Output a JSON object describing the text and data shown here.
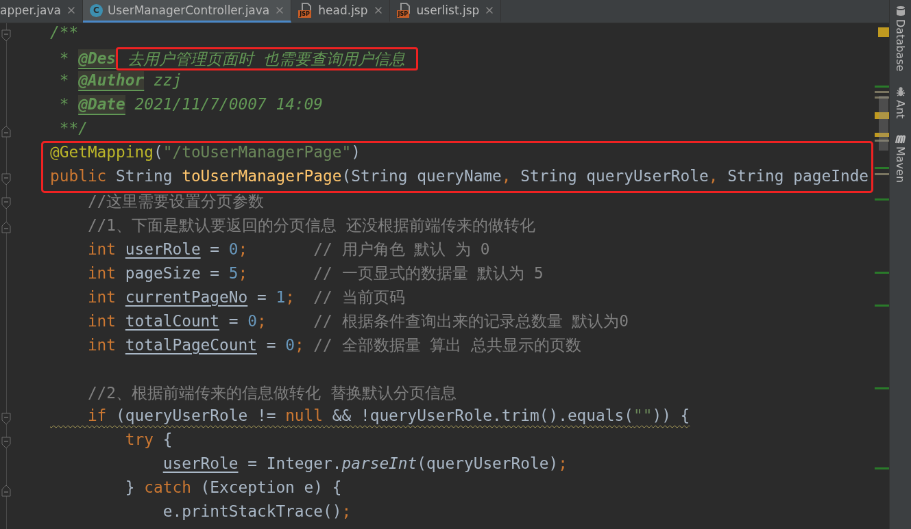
{
  "tabs": [
    {
      "label": "apper.java",
      "kind": "plain",
      "selected": false
    },
    {
      "label": "UserManagerController.java",
      "kind": "class",
      "badge": "C",
      "selected": true
    },
    {
      "label": "head.jsp",
      "kind": "jsp",
      "badge": "JSP",
      "selected": false
    },
    {
      "label": "userlist.jsp",
      "kind": "jsp",
      "badge": "JSP",
      "selected": false
    }
  ],
  "lines": [
    {
      "fold_start": true,
      "tokens": [
        {
          "kind": "doc",
          "t": "/**"
        }
      ]
    },
    {
      "tokens": [
        {
          "kind": "doc",
          "t": " * "
        },
        {
          "kind": "doctag",
          "t": "@Des"
        },
        {
          "kind": "doc",
          "t": " 去用户管理页面时 也需要查询用户信息",
          "boxed": true
        }
      ]
    },
    {
      "tokens": [
        {
          "kind": "doc",
          "t": " * "
        },
        {
          "kind": "doctag",
          "t": "@Author"
        },
        {
          "kind": "doc",
          "t": " zzj"
        }
      ]
    },
    {
      "tokens": [
        {
          "kind": "doc",
          "t": " * "
        },
        {
          "kind": "doctag",
          "t": "@Date"
        },
        {
          "kind": "doc",
          "t": " 2021/11/7/0007 14:09"
        }
      ]
    },
    {
      "fold_end": true,
      "tokens": [
        {
          "kind": "doc",
          "t": " **/"
        }
      ]
    },
    {
      "boxed": true,
      "tokens": [
        {
          "kind": "ann",
          "t": "@GetMapping"
        },
        {
          "kind": "plain",
          "t": "("
        },
        {
          "kind": "str",
          "t": "\"/toUserManagerPage\""
        },
        {
          "kind": "plain",
          "t": ")"
        }
      ]
    },
    {
      "boxed": true,
      "fold_start": true,
      "tokens": [
        {
          "kind": "kw",
          "t": "public "
        },
        {
          "kind": "plain",
          "t": "String "
        },
        {
          "kind": "fn",
          "t": "toUserManagerPage"
        },
        {
          "kind": "plain",
          "t": "(String queryName"
        },
        {
          "kind": "punct",
          "t": ", "
        },
        {
          "kind": "plain",
          "t": "String queryUserRole"
        },
        {
          "kind": "punct",
          "t": ", "
        },
        {
          "kind": "plain",
          "t": "String pageInde"
        }
      ]
    },
    {
      "fold_start": true,
      "tokens": [
        {
          "kind": "cm",
          "t": "    //这里需要设置分页参数"
        }
      ]
    },
    {
      "fold_end": true,
      "tokens": [
        {
          "kind": "cm",
          "t": "    //1、下面是默认要返回的分页信息 还没根据前端传来的做转化"
        }
      ]
    },
    {
      "tokens": [
        {
          "kind": "kw",
          "t": "    int "
        },
        {
          "kind": "field",
          "t": "userRole"
        },
        {
          "kind": "plain",
          "t": " = "
        },
        {
          "kind": "num",
          "t": "0"
        },
        {
          "kind": "punct",
          "t": ";"
        },
        {
          "kind": "cm",
          "t": "       // 用户角色 默认 为 0"
        }
      ]
    },
    {
      "tokens": [
        {
          "kind": "kw",
          "t": "    int "
        },
        {
          "kind": "plain",
          "t": "pageSize = "
        },
        {
          "kind": "num",
          "t": "5"
        },
        {
          "kind": "punct",
          "t": ";"
        },
        {
          "kind": "cm",
          "t": "       // 一页显式的数据量 默认为 5"
        }
      ]
    },
    {
      "tokens": [
        {
          "kind": "kw",
          "t": "    int "
        },
        {
          "kind": "field",
          "t": "currentPageNo"
        },
        {
          "kind": "plain",
          "t": " = "
        },
        {
          "kind": "num",
          "t": "1"
        },
        {
          "kind": "punct",
          "t": ";"
        },
        {
          "kind": "cm",
          "t": "  // 当前页码"
        }
      ]
    },
    {
      "tokens": [
        {
          "kind": "kw",
          "t": "    int "
        },
        {
          "kind": "field",
          "t": "totalCount"
        },
        {
          "kind": "plain",
          "t": " = "
        },
        {
          "kind": "num",
          "t": "0"
        },
        {
          "kind": "punct",
          "t": ";"
        },
        {
          "kind": "cm",
          "t": "     // 根据条件查询出来的记录总数量 默认为0"
        }
      ]
    },
    {
      "tokens": [
        {
          "kind": "kw",
          "t": "    int "
        },
        {
          "kind": "field",
          "t": "totalPageCount"
        },
        {
          "kind": "plain",
          "t": " = "
        },
        {
          "kind": "num",
          "t": "0"
        },
        {
          "kind": "punct",
          "t": ";"
        },
        {
          "kind": "cm",
          "t": " // 全部数据量 算出 总共显示的页数"
        }
      ]
    },
    {
      "space_above": true,
      "tokens": [
        {
          "kind": "cm",
          "t": "    //2、根据前端传来的信息做转化 替换默认分页信息"
        }
      ]
    },
    {
      "warning": true,
      "fold_start": true,
      "tokens": [
        {
          "kind": "kw",
          "t": "    if"
        },
        {
          "kind": "plain",
          "t": " (queryUserRole != "
        },
        {
          "kind": "kw",
          "t": "null"
        },
        {
          "kind": "plain",
          "t": " && !queryUserRole.trim().equals("
        },
        {
          "kind": "str",
          "t": "\"\""
        },
        {
          "kind": "plain",
          "t": ")) {"
        }
      ]
    },
    {
      "fold_start": true,
      "tokens": [
        {
          "kind": "kw",
          "t": "        try"
        },
        {
          "kind": "plain",
          "t": " {"
        }
      ]
    },
    {
      "tokens": [
        {
          "kind": "field",
          "t": "            userRole"
        },
        {
          "kind": "plain",
          "t": " = Integer."
        },
        {
          "kind": "italic",
          "t": "parseInt"
        },
        {
          "kind": "plain",
          "t": "(queryUserRole)"
        },
        {
          "kind": "punct",
          "t": ";"
        }
      ]
    },
    {
      "fold_end": true,
      "tokens": [
        {
          "kind": "plain",
          "t": "        } "
        },
        {
          "kind": "kw",
          "t": "catch"
        },
        {
          "kind": "plain",
          "t": " (Exception e) {"
        }
      ]
    },
    {
      "tokens": [
        {
          "kind": "plain",
          "t": "            e.printStackTrace()"
        },
        {
          "kind": "punct",
          "t": ";"
        }
      ]
    }
  ],
  "tool_windows": [
    {
      "label": "Database",
      "kind": "database"
    },
    {
      "label": "Ant",
      "kind": "ant"
    },
    {
      "label": "Maven",
      "kind": "maven"
    }
  ]
}
